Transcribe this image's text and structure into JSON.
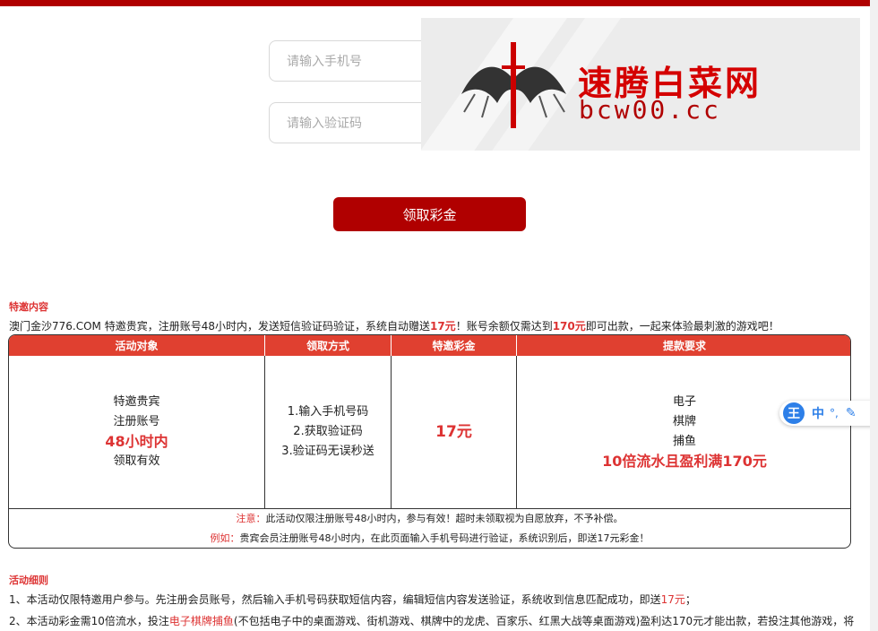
{
  "form": {
    "phone_placeholder": "请输入手机号",
    "code_placeholder": "请输入验证码",
    "claim_button": "领取彩金"
  },
  "banner": {
    "cn_text": "速腾白菜网",
    "domain_text": "bcw00.cc"
  },
  "invite": {
    "title": "特邀内容",
    "intro_1": "澳门金沙776.COM 特邀贵宾，注册账号48小时内，发送短信验证码验证，系统自动赠送",
    "intro_amount": "17元",
    "intro_2": "！账号余额仅需达到",
    "intro_target": "170元",
    "intro_3": "即可出款，一起来体验最刺激的游戏吧！"
  },
  "table": {
    "headers": [
      "活动对象",
      "领取方式",
      "特邀彩金",
      "提款要求"
    ],
    "col1": {
      "line1": "特邀贵宾",
      "line2": "注册账号",
      "big": "48小时内",
      "line3": "领取有效"
    },
    "col2": {
      "line1": "1.输入手机号码",
      "line2": "2.获取验证码",
      "line3": "3.验证码无误秒送"
    },
    "col3": {
      "big": "17元"
    },
    "col4": {
      "line1": "电子",
      "line2": "棋牌",
      "line3": "捕鱼",
      "big": "10倍流水且盈利满170元"
    },
    "note_label": "注意：",
    "note_text": "此活动仅限注册账号48小时内，参与有效！超时未领取视为自愿放弃，不予补偿。",
    "example_label": "例如：",
    "example_text": "贵宾会员注册账号48小时内，在此页面输入手机号码进行验证，系统识别后，即送17元彩金！"
  },
  "rules": {
    "title": "活动细则",
    "rule1": "1、本活动仅限特邀用户参与。先注册会员账号，然后输入手机号码获取短信内容，编辑短信内容发送验证，系统收到信息匹配成功，即送",
    "rule1_amount": "17元",
    "rule1_end": "；",
    "rule2": "2、本活动彩金需10倍流水，投注",
    "rule2_red": "电子棋牌捕鱼",
    "rule2_rest": "(不包括电子中的桌面游戏、街机游戏、棋牌中的龙虎、百家乐、红黑大战等桌面游戏)盈利达170元才能出款，若投注其他游戏，将"
  },
  "ime": {
    "logo": "王",
    "lang": "中"
  }
}
